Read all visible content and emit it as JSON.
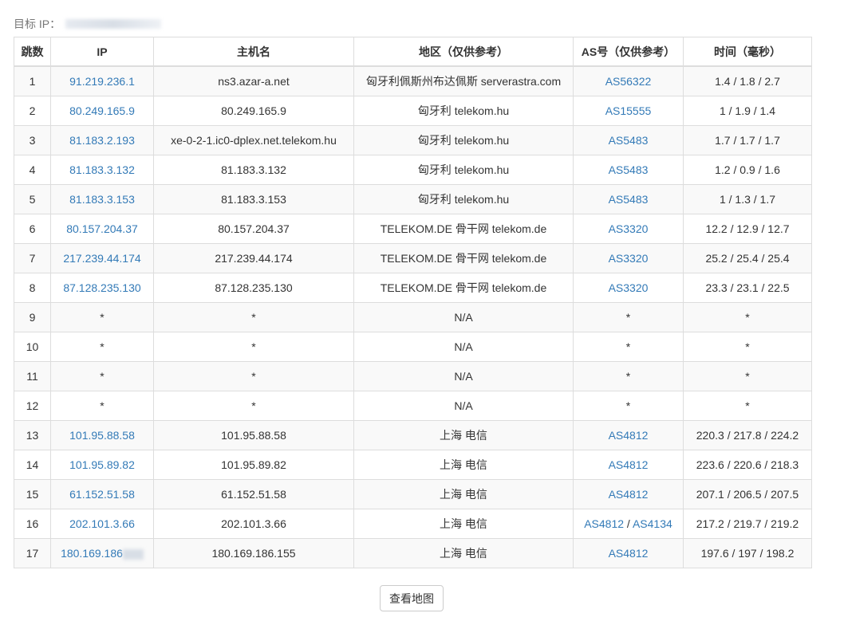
{
  "target_label": "目标 IP：",
  "headers": [
    "跳数",
    "IP",
    "主机名",
    "地区（仅供参考）",
    "AS号（仅供参考）",
    "时间（毫秒）"
  ],
  "rows": [
    {
      "hop": "1",
      "ip": "91.219.236.1",
      "host": "ns3.azar-a.net",
      "region": "匈牙利佩斯州布达佩斯 serverastra.com",
      "as": [
        "AS56322"
      ],
      "time": "1.4 / 1.8 / 2.7"
    },
    {
      "hop": "2",
      "ip": "80.249.165.9",
      "host": "80.249.165.9",
      "region": "匈牙利 telekom.hu",
      "as": [
        "AS15555"
      ],
      "time": "1 / 1.9 / 1.4"
    },
    {
      "hop": "3",
      "ip": "81.183.2.193",
      "host": "xe-0-2-1.ic0-dplex.net.telekom.hu",
      "region": "匈牙利 telekom.hu",
      "as": [
        "AS5483"
      ],
      "time": "1.7 / 1.7 / 1.7"
    },
    {
      "hop": "4",
      "ip": "81.183.3.132",
      "host": "81.183.3.132",
      "region": "匈牙利 telekom.hu",
      "as": [
        "AS5483"
      ],
      "time": "1.2 / 0.9 / 1.6"
    },
    {
      "hop": "5",
      "ip": "81.183.3.153",
      "host": "81.183.3.153",
      "region": "匈牙利 telekom.hu",
      "as": [
        "AS5483"
      ],
      "time": "1 / 1.3 / 1.7"
    },
    {
      "hop": "6",
      "ip": "80.157.204.37",
      "host": "80.157.204.37",
      "region": "TELEKOM.DE 骨干网 telekom.de",
      "as": [
        "AS3320"
      ],
      "time": "12.2 / 12.9 / 12.7"
    },
    {
      "hop": "7",
      "ip": "217.239.44.174",
      "host": "217.239.44.174",
      "region": "TELEKOM.DE 骨干网 telekom.de",
      "as": [
        "AS3320"
      ],
      "time": "25.2 / 25.4 / 25.4"
    },
    {
      "hop": "8",
      "ip": "87.128.235.130",
      "host": "87.128.235.130",
      "region": "TELEKOM.DE 骨干网 telekom.de",
      "as": [
        "AS3320"
      ],
      "time": "23.3 / 23.1 / 22.5"
    },
    {
      "hop": "9",
      "ip": "*",
      "host": "*",
      "region": "N/A",
      "as": [
        "*"
      ],
      "time": "*"
    },
    {
      "hop": "10",
      "ip": "*",
      "host": "*",
      "region": "N/A",
      "as": [
        "*"
      ],
      "time": "*"
    },
    {
      "hop": "11",
      "ip": "*",
      "host": "*",
      "region": "N/A",
      "as": [
        "*"
      ],
      "time": "*"
    },
    {
      "hop": "12",
      "ip": "*",
      "host": "*",
      "region": "N/A",
      "as": [
        "*"
      ],
      "time": "*"
    },
    {
      "hop": "13",
      "ip": "101.95.88.58",
      "host": "101.95.88.58",
      "region": "上海 电信",
      "as": [
        "AS4812"
      ],
      "time": "220.3 / 217.8 / 224.2"
    },
    {
      "hop": "14",
      "ip": "101.95.89.82",
      "host": "101.95.89.82",
      "region": "上海 电信",
      "as": [
        "AS4812"
      ],
      "time": "223.6 / 220.6 / 218.3"
    },
    {
      "hop": "15",
      "ip": "61.152.51.58",
      "host": "61.152.51.58",
      "region": "上海 电信",
      "as": [
        "AS4812"
      ],
      "time": "207.1 / 206.5 / 207.5"
    },
    {
      "hop": "16",
      "ip": "202.101.3.66",
      "host": "202.101.3.66",
      "region": "上海 电信",
      "as": [
        "AS4812",
        "AS4134"
      ],
      "time": "217.2 / 219.7 / 219.2"
    },
    {
      "hop": "17",
      "ip": "180.169.186",
      "ip_blurred": true,
      "host": "180.169.186.155",
      "region": "上海 电信",
      "as": [
        "AS4812"
      ],
      "time": "197.6 / 197 / 198.2"
    }
  ],
  "as_separator": " / ",
  "map_button": "查看地图"
}
